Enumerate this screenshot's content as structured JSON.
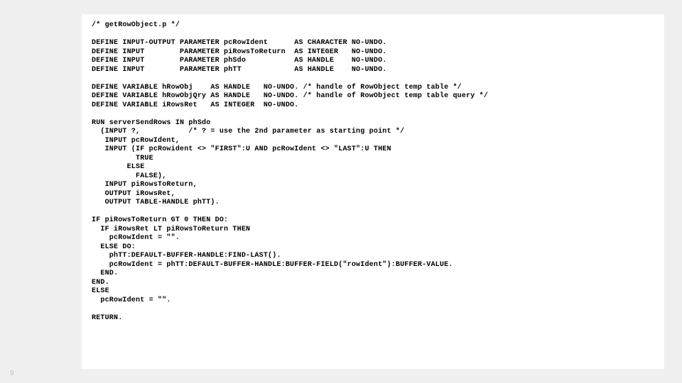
{
  "slide": {
    "number": "9"
  },
  "code": {
    "lines": [
      "/* getRowObject.p */",
      "",
      "DEFINE INPUT-OUTPUT PARAMETER pcRowIdent      AS CHARACTER NO-UNDO.",
      "DEFINE INPUT        PARAMETER piRowsToReturn  AS INTEGER   NO-UNDO.",
      "DEFINE INPUT        PARAMETER phSdo           AS HANDLE    NO-UNDO.",
      "DEFINE INPUT        PARAMETER phTT            AS HANDLE    NO-UNDO.",
      "",
      "DEFINE VARIABLE hRowObj    AS HANDLE   NO-UNDO. /* handle of RowObject temp table */",
      "DEFINE VARIABLE hRowObjQry AS HANDLE   NO-UNDO. /* handle of RowObject temp table query */",
      "DEFINE VARIABLE iRowsRet   AS INTEGER  NO-UNDO.",
      "",
      "RUN serverSendRows IN phSdo",
      "  (INPUT ?,           /* ? = use the 2nd parameter as starting point */",
      "   INPUT pcRowIdent,",
      "   INPUT (IF pcRowident <> \"FIRST\":U AND pcRowIdent <> \"LAST\":U THEN",
      "          TRUE",
      "        ELSE",
      "          FALSE),",
      "   INPUT piRowsToReturn,",
      "   OUTPUT iRowsRet,",
      "   OUTPUT TABLE-HANDLE phTT).",
      "",
      "IF piRowsToReturn GT 0 THEN DO:",
      "  IF iRowsRet LT piRowsToReturn THEN",
      "    pcRowIdent = \"\".",
      "  ELSE DO:",
      "    phTT:DEFAULT-BUFFER-HANDLE:FIND-LAST().",
      "    pcRowIdent = phTT:DEFAULT-BUFFER-HANDLE:BUFFER-FIELD(\"rowIdent\"):BUFFER-VALUE.",
      "  END.",
      "END.",
      "ELSE",
      "  pcRowIdent = \"\".",
      "",
      "RETURN."
    ]
  }
}
